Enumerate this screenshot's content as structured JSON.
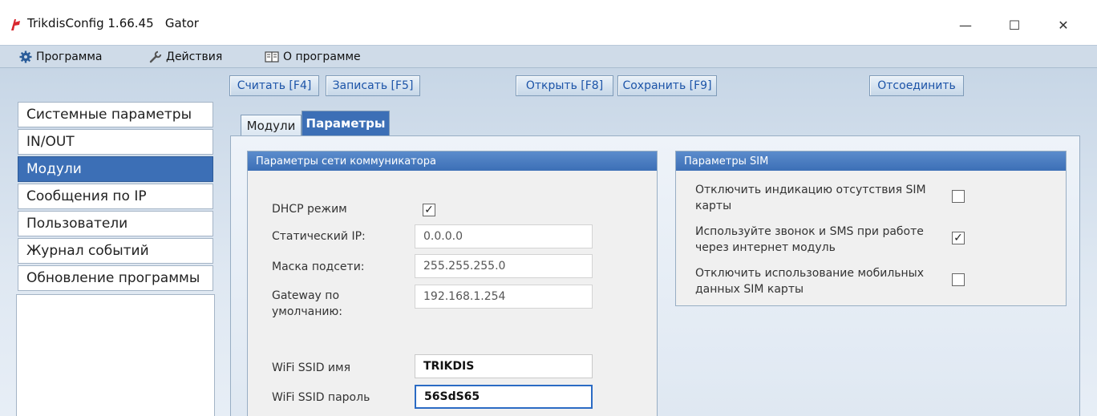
{
  "window": {
    "title": "TrikdisConfig 1.66.45   Gator",
    "minimize_glyph": "—",
    "maximize_glyph": "☐",
    "close_glyph": "✕"
  },
  "menu": {
    "program": "Программа",
    "actions": "Действия",
    "about": "О программе"
  },
  "toolbar": {
    "read": "Считать [F4]",
    "write": "Записать [F5]",
    "open": "Открыть [F8]",
    "save": "Сохранить [F9]",
    "disconnect": "Отсоединить"
  },
  "sidebar": {
    "items": [
      {
        "label": "Системные параметры"
      },
      {
        "label": "IN/OUT"
      },
      {
        "label": "Модули"
      },
      {
        "label": "Сообщения по IP"
      },
      {
        "label": "Пользователи"
      },
      {
        "label": "Журнал событий"
      },
      {
        "label": "Обновление программы"
      }
    ],
    "active_index": 2
  },
  "tabs": {
    "modules": "Модули",
    "parameters": "Параметры"
  },
  "network": {
    "title": "Параметры сети коммуникатора",
    "dhcp_label": "DHCP режим",
    "dhcp_checked": true,
    "static_ip_label": "Статический IP:",
    "static_ip_value": "0.0.0.0",
    "mask_label": "Маска подсети:",
    "mask_value": "255.255.255.0",
    "gateway_label": "Gateway по умолчанию:",
    "gateway_value": "192.168.1.254",
    "ssid_label": "WiFi SSID имя",
    "ssid_value": "TRIKDIS",
    "password_label": "WiFi SSID пароль",
    "password_value": "56SdS65"
  },
  "sim": {
    "title": "Параметры SIM",
    "items": [
      {
        "label": "Отключить индикацию отсутствия SIM карты",
        "checked": false
      },
      {
        "label": "Используйте звонок и SMS при работе через интернет модуль",
        "checked": true
      },
      {
        "label": "Отключить использование мобильных данных SIM карты",
        "checked": false
      }
    ]
  },
  "check_glyph": "✓",
  "colors": {
    "accent": "#3c6fb6",
    "menubar": "#cfdbe8",
    "toolbar_text": "#1c54a8"
  }
}
